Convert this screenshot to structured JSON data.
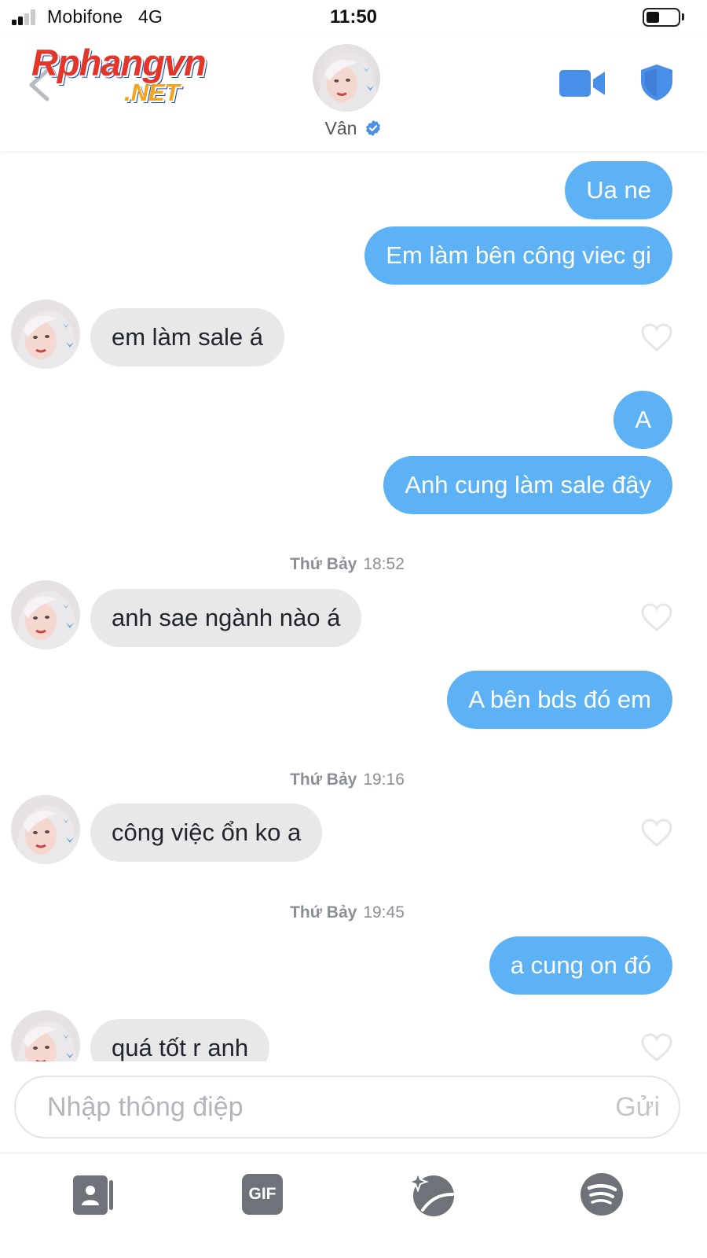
{
  "status_bar": {
    "carrier": "Mobifone",
    "network": "4G",
    "time": "11:50",
    "signal_bars_active": 2,
    "battery_level": 0.35
  },
  "header": {
    "logo_main": "Rphangvn",
    "logo_sub": ".NET",
    "contact_name": "Vân",
    "verified": true
  },
  "messages": [
    {
      "direction": "sent",
      "text": "Ua ne"
    },
    {
      "direction": "sent",
      "text": "Em làm bên công viec gi"
    },
    {
      "direction": "received",
      "text": "em làm sale á"
    },
    {
      "direction": "sent",
      "text": "A"
    },
    {
      "direction": "sent",
      "text": "Anh cung làm sale đây"
    },
    {
      "timestamp_day": "Thứ Bảy",
      "timestamp_time": "18:52"
    },
    {
      "direction": "received",
      "text": "anh sae ngành nào á"
    },
    {
      "direction": "sent",
      "text": "A bên bds đó em"
    },
    {
      "timestamp_day": "Thứ Bảy",
      "timestamp_time": "19:16"
    },
    {
      "direction": "received",
      "text": "công việc ổn ko a"
    },
    {
      "timestamp_day": "Thứ Bảy",
      "timestamp_time": "19:45"
    },
    {
      "direction": "sent",
      "text": "a cung on đó"
    },
    {
      "direction": "received",
      "text": "quá tốt r anh"
    }
  ],
  "composer": {
    "placeholder": "Nhập thông điệp",
    "value": "",
    "send_label": "Gửi"
  },
  "toolbar": {
    "gif_label": "GIF",
    "items": [
      "contact-card-icon",
      "gif-icon",
      "sparkle-sticker-icon",
      "spotify-icon"
    ]
  },
  "colors": {
    "sent_bubble": "#5cb2f4",
    "received_bubble": "#e8e8e9",
    "accent_blue": "#4a8fe7",
    "toolbar_icon": "#6e737a"
  }
}
